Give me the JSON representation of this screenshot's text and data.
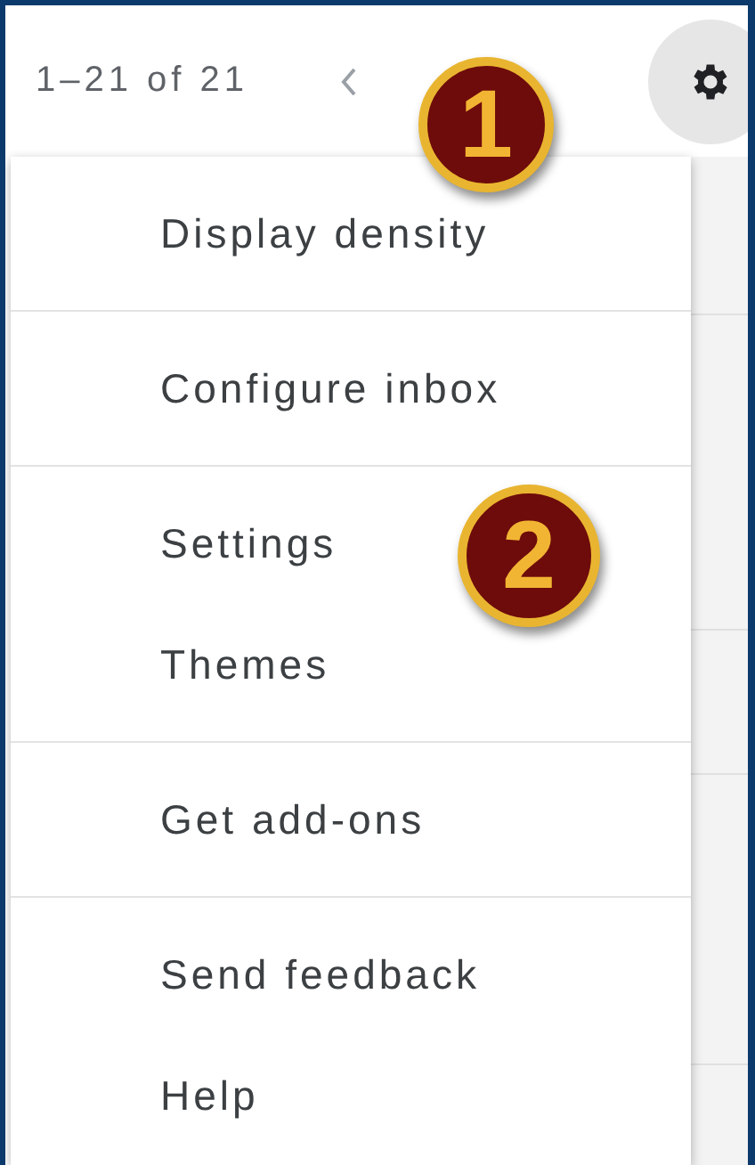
{
  "toolbar": {
    "page_range": "1–21 of 21"
  },
  "settings_menu": {
    "sections": [
      [
        "Display density"
      ],
      [
        "Configure inbox"
      ],
      [
        "Settings",
        "Themes"
      ],
      [
        "Get add-ons"
      ],
      [
        "Send feedback",
        "Help"
      ]
    ]
  },
  "callouts": [
    {
      "label": "1"
    },
    {
      "label": "2"
    }
  ]
}
